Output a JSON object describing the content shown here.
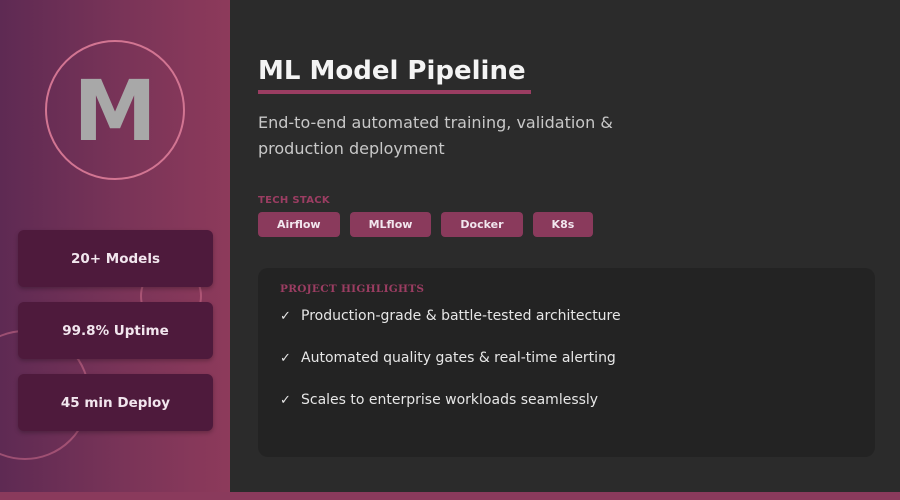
{
  "sidebar": {
    "logo_letter": "M",
    "stats": [
      {
        "label": "20+ Models"
      },
      {
        "label": "99.8% Uptime"
      },
      {
        "label": "45 min Deploy"
      }
    ]
  },
  "main": {
    "title": "ML Model Pipeline",
    "subtitle": "End-to-end automated training, validation & production deployment",
    "tech_stack": {
      "label": "TECH STACK",
      "items": [
        "Airflow",
        "MLflow",
        "Docker",
        "K8s"
      ]
    },
    "highlights": {
      "label": "PROJECT HIGHLIGHTS",
      "check_icon": "check-icon",
      "items": [
        "Production-grade & battle-tested architecture",
        "Automated quality gates & real-time alerting",
        "Scales to enterprise workloads seamlessly"
      ]
    }
  },
  "colors": {
    "accent": "#8a3a5c",
    "stat_card": "#4e1a3c",
    "background": "#2b2b2b",
    "panel": "#232323"
  }
}
